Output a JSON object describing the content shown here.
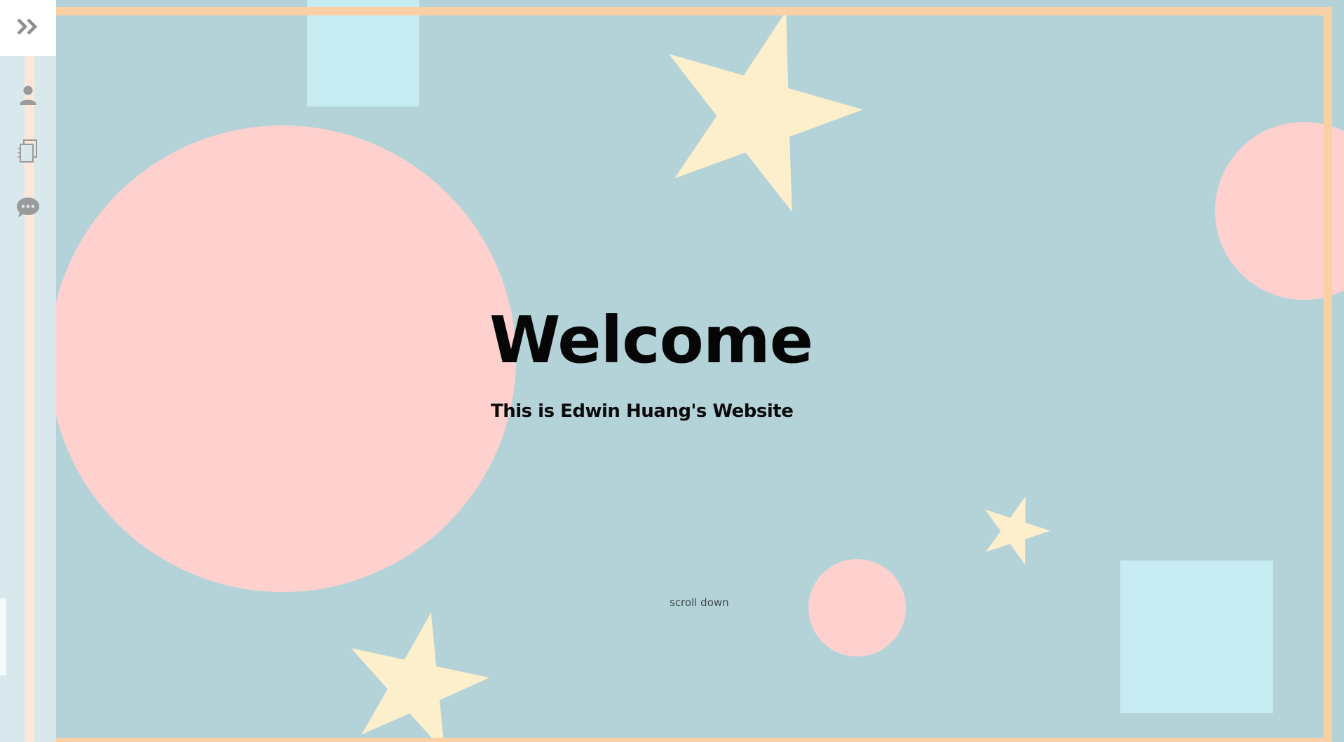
{
  "hero": {
    "title": "Welcome",
    "subtitle": "This is Edwin Huang's Website",
    "scroll_label": "scroll down"
  },
  "sidebar": {
    "toggle_icon": "double-chevron-right-icon",
    "items": [
      {
        "icon": "person-icon"
      },
      {
        "icon": "documents-icon"
      },
      {
        "icon": "chat-bubble-icon"
      }
    ]
  },
  "colors": {
    "background": "#b4d3d8",
    "circle": "#fed1cf",
    "square": "#c6ecf2",
    "star": "#feefcc",
    "frame": "#fbd0a5",
    "sidebar": "#d8e8ed",
    "icon": "#9a9a9a"
  }
}
